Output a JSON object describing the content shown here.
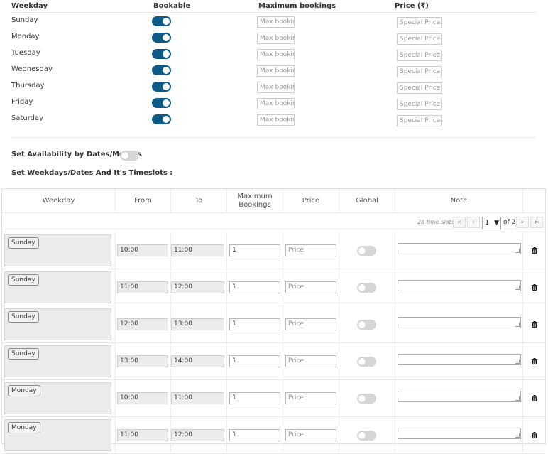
{
  "weekdays_table": {
    "headers": {
      "weekday": "Weekday",
      "bookable": "Bookable",
      "max_bookings": "Maximum bookings",
      "price": "Price (₹)"
    },
    "rows": [
      {
        "day": "Sunday",
        "bookable": true,
        "max_placeholder": "Max bookings",
        "price_placeholder": "Special Price"
      },
      {
        "day": "Monday",
        "bookable": true,
        "max_placeholder": "Max bookings",
        "price_placeholder": "Special Price"
      },
      {
        "day": "Tuesday",
        "bookable": true,
        "max_placeholder": "Max bookings",
        "price_placeholder": "Special Price"
      },
      {
        "day": "Wednesday",
        "bookable": true,
        "max_placeholder": "Max bookings",
        "price_placeholder": "Special Price"
      },
      {
        "day": "Thursday",
        "bookable": true,
        "max_placeholder": "Max bookings",
        "price_placeholder": "Special Price"
      },
      {
        "day": "Friday",
        "bookable": true,
        "max_placeholder": "Max bookings",
        "price_placeholder": "Special Price"
      },
      {
        "day": "Saturday",
        "bookable": true,
        "max_placeholder": "Max bookings",
        "price_placeholder": "Special Price"
      }
    ]
  },
  "availability": {
    "label": "Set Availability by Dates/Months",
    "enabled": false
  },
  "timeslots_heading": "Set Weekdays/Dates And It's Timeslots :",
  "timeslots_table": {
    "headers": {
      "weekday": "Weekday",
      "from": "From",
      "to": "To",
      "max_bookings": "Maximum Bookings",
      "price": "Price",
      "global": "Global",
      "note": "Note"
    },
    "pagination": {
      "count": "28 time slots",
      "first": "«",
      "prev": "‹",
      "current": "1",
      "of": "of 2",
      "next": "›",
      "last": "»"
    },
    "rows": [
      {
        "day": "Sunday",
        "from": "10:00",
        "to": "11:00",
        "max": "1",
        "price_placeholder": "Price",
        "global": false
      },
      {
        "day": "Sunday",
        "from": "11:00",
        "to": "12:00",
        "max": "1",
        "price_placeholder": "Price",
        "global": false
      },
      {
        "day": "Sunday",
        "from": "12:00",
        "to": "13:00",
        "max": "1",
        "price_placeholder": "Price",
        "global": false
      },
      {
        "day": "Sunday",
        "from": "13:00",
        "to": "14:00",
        "max": "1",
        "price_placeholder": "Price",
        "global": false
      },
      {
        "day": "Monday",
        "from": "10:00",
        "to": "11:00",
        "max": "1",
        "price_placeholder": "Price",
        "global": false
      },
      {
        "day": "Monday",
        "from": "11:00",
        "to": "12:00",
        "max": "1",
        "price_placeholder": "Price",
        "global": false
      }
    ]
  },
  "colors": {
    "toggle_on": "#0e5a86",
    "toggle_off": "#d6d6d6"
  }
}
